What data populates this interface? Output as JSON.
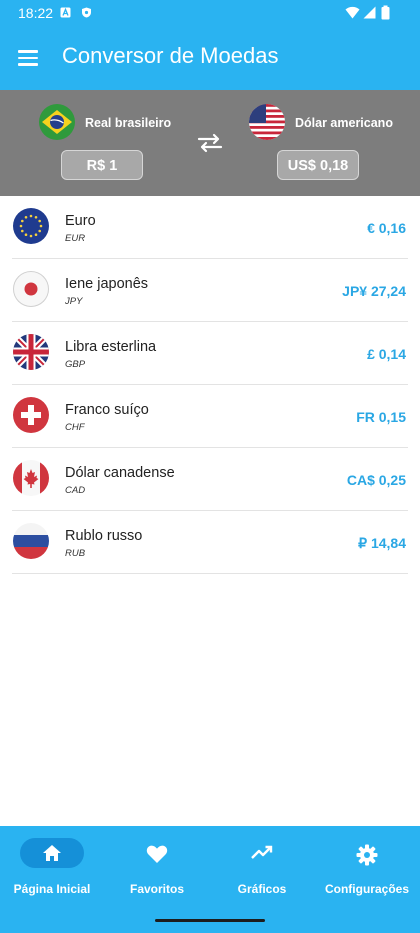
{
  "status_bar": {
    "time": "18:22"
  },
  "app": {
    "title": "Conversor de Moedas"
  },
  "converter": {
    "from": {
      "name": "Real brasileiro",
      "value": "R$  1",
      "flag": "flag-brazil"
    },
    "to": {
      "name": "Dólar americano",
      "value": "US$  0,18",
      "flag": "flag-usa"
    },
    "swap_icon": "swap-horizontal-icon"
  },
  "currencies": [
    {
      "name": "Euro",
      "code": "EUR",
      "value": "€  0,16",
      "flag": "flag-eu"
    },
    {
      "name": "Iene japonês",
      "code": "JPY",
      "value": "JP¥  27,24",
      "flag": "flag-japan"
    },
    {
      "name": "Libra esterlina",
      "code": "GBP",
      "value": "£  0,14",
      "flag": "flag-uk"
    },
    {
      "name": "Franco suíço",
      "code": "CHF",
      "value": "FR  0,15",
      "flag": "flag-switzerland"
    },
    {
      "name": "Dólar canadense",
      "code": "CAD",
      "value": "CA$  0,25",
      "flag": "flag-canada"
    },
    {
      "name": "Rublo russo",
      "code": "RUB",
      "value": "₽  14,84",
      "flag": "flag-russia"
    }
  ],
  "bottom_nav": {
    "items": [
      {
        "label": "Página Inicial",
        "icon": "home-icon",
        "active": true
      },
      {
        "label": "Favoritos",
        "icon": "heart-icon",
        "active": false
      },
      {
        "label": "Gráficos",
        "icon": "trending-up-icon",
        "active": false
      },
      {
        "label": "Configurações",
        "icon": "settings-gear-icon",
        "active": false
      }
    ]
  },
  "colors": {
    "primary": "#2ab3f1",
    "active_pill": "#1590d8",
    "value_text": "#2aa7e4",
    "converter_bg": "#7d7d7d"
  }
}
